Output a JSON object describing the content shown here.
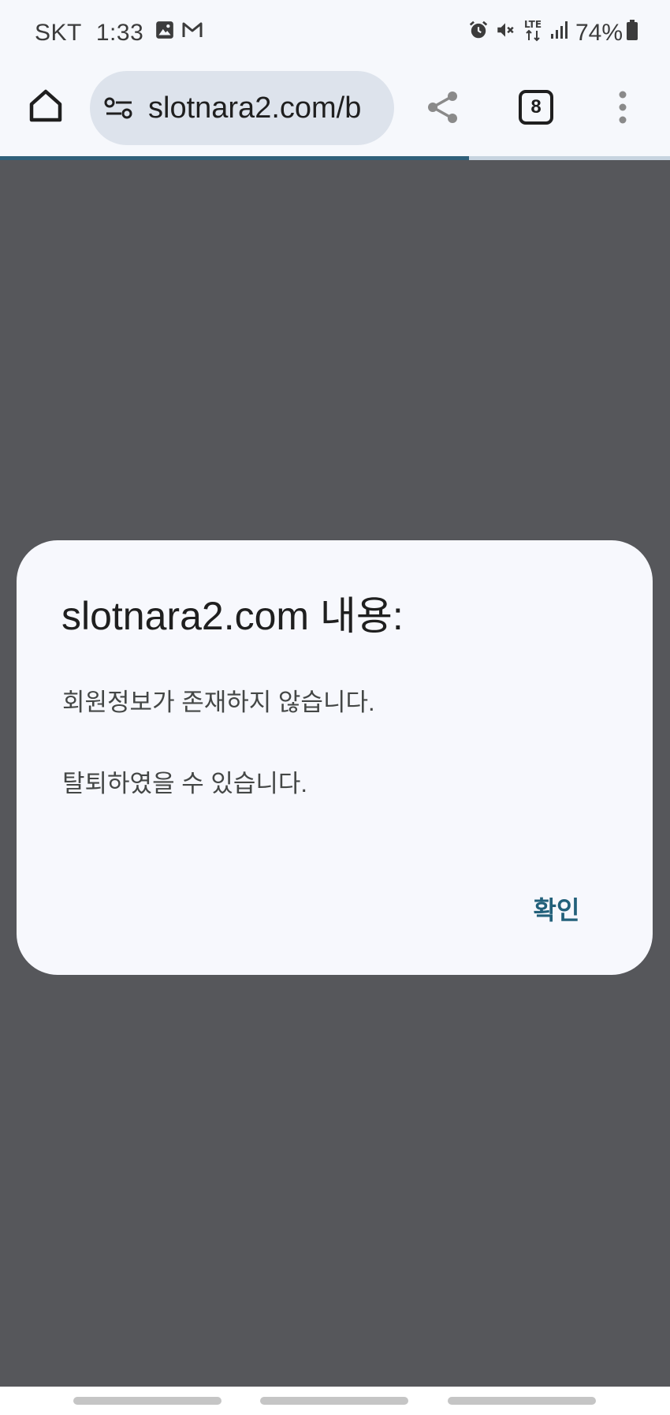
{
  "status_bar": {
    "carrier": "SKT",
    "time": "1:33",
    "left_icons": [
      "image-icon",
      "gmail-icon"
    ],
    "right_icons": [
      "alarm-icon",
      "mute-icon",
      "lte-icon",
      "signal-icon",
      "battery-icon"
    ],
    "lte_label": "LTE",
    "battery": "74%"
  },
  "toolbar": {
    "url": "slotnara2.com/b",
    "tab_count": "8"
  },
  "page_load_progress": 0.7,
  "dialog": {
    "title": "slotnara2.com 내용:",
    "line1": "회원정보가 존재하지 않습니다.",
    "line2": "탈퇴하였을 수 있습니다.",
    "confirm_label": "확인"
  },
  "colors": {
    "accent": "#22607a",
    "scrim": "#56575b",
    "dialog_bg": "#f7f8fd",
    "chrome_bg": "#f6f8fc"
  }
}
